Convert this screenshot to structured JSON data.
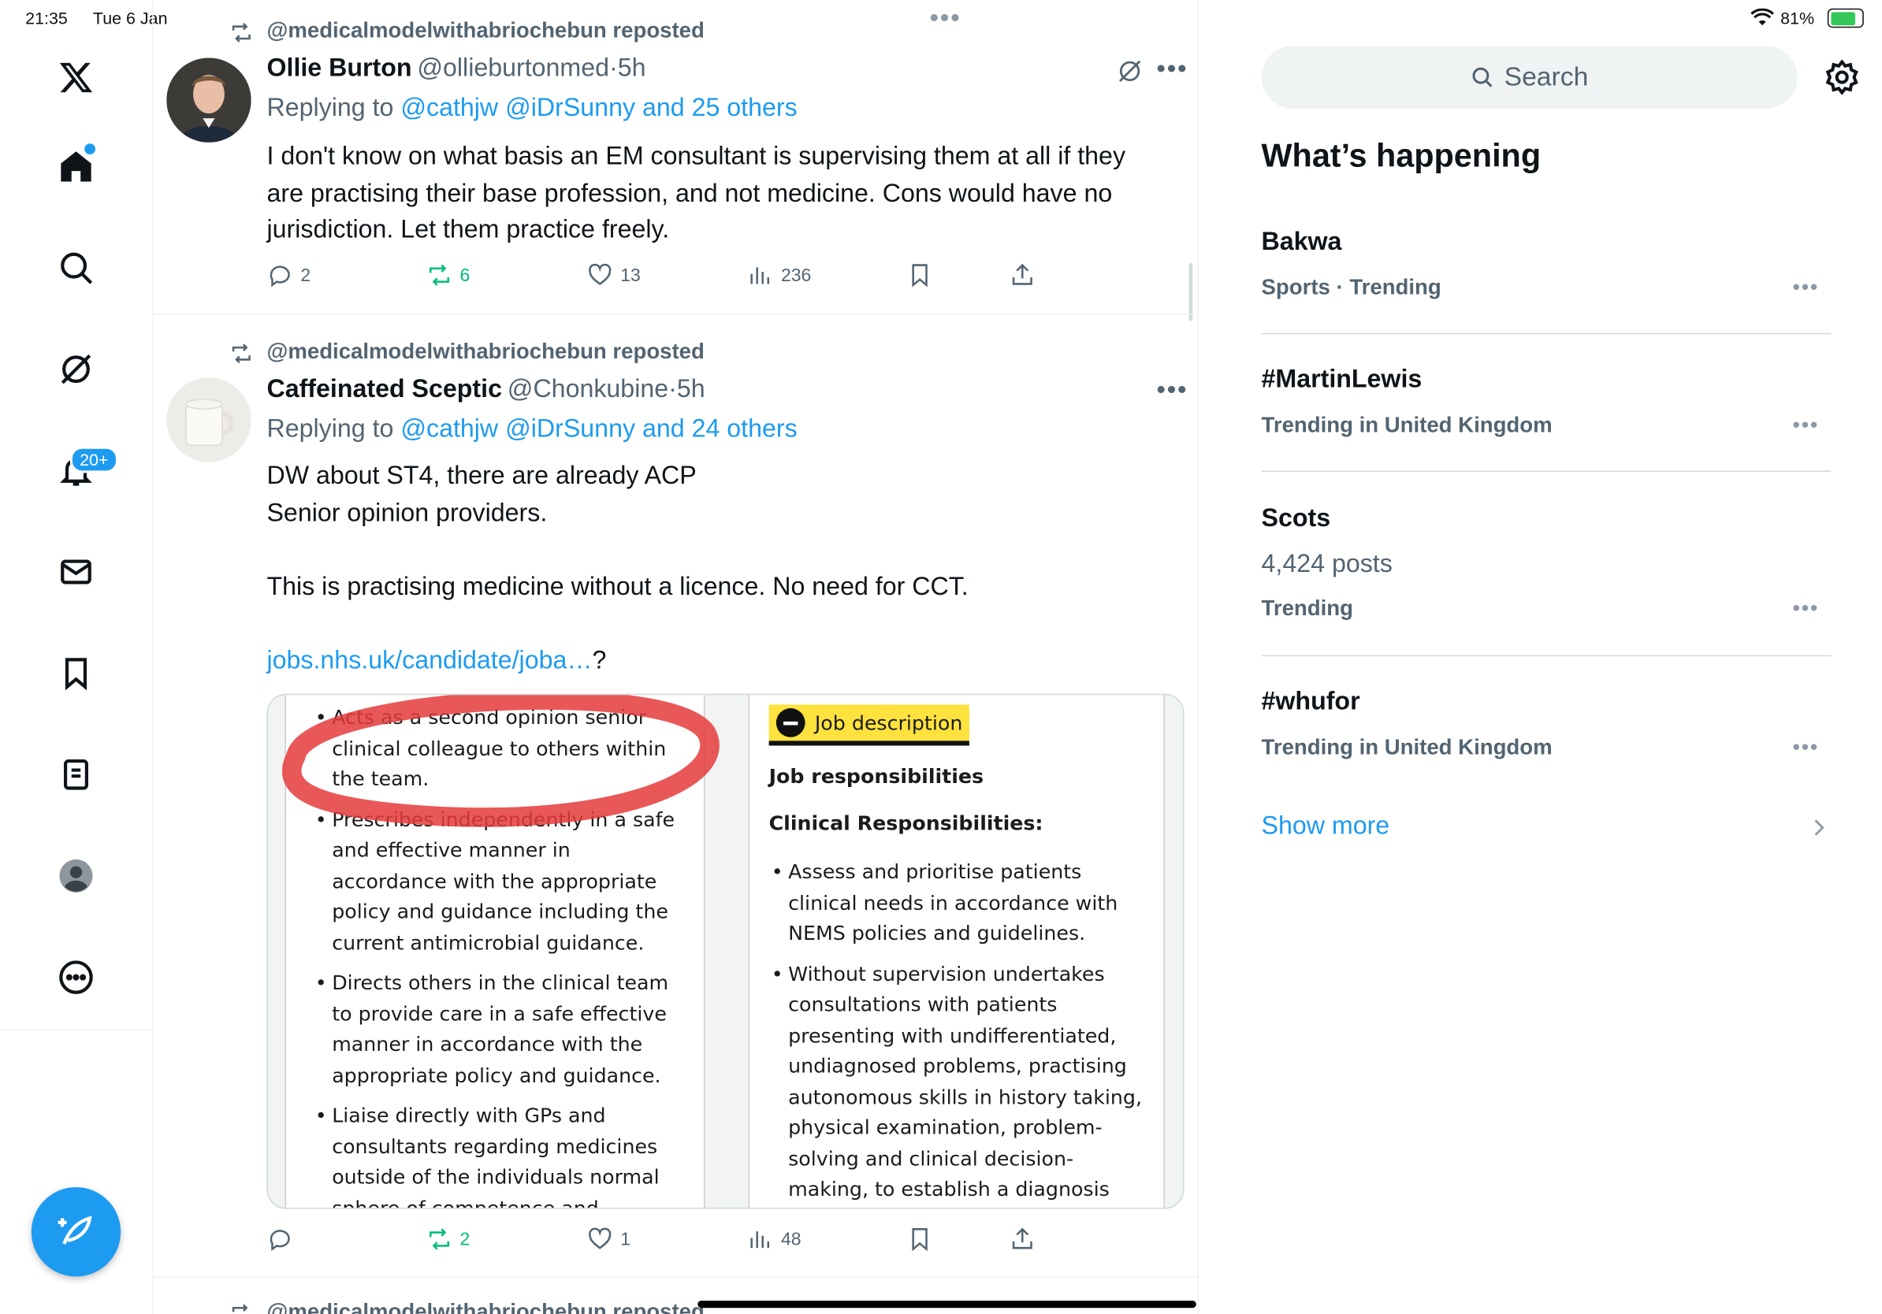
{
  "status": {
    "time": "21:35",
    "date": "Tue 6 Jan",
    "battery": "81%"
  },
  "nav": {
    "notifications_badge": "20+",
    "items": [
      "x-logo",
      "home",
      "search",
      "grok",
      "notifications",
      "messages",
      "bookmarks",
      "lists",
      "profile",
      "more"
    ]
  },
  "tweets": [
    {
      "repost_label": "@medicalmodelwithabriochebun reposted",
      "name": "Ollie Burton",
      "handle": "@ollieburtonmed",
      "sep": "·",
      "time": "5h",
      "replying_prefix": "Replying to ",
      "replying_to": "@cathjw @iDrSunny and 25 others",
      "body_lines": [
        "I don't know on what basis an EM consultant is supervising them at all if they",
        "are practising their base profession, and not medicine. Cons would have no",
        "jurisdiction. Let them practice freely."
      ],
      "replies": "2",
      "reposts": "6",
      "likes": "13",
      "views": "236"
    },
    {
      "repost_label": "@medicalmodelwithabriochebun reposted",
      "name": "Caffeinated Sceptic",
      "handle": "@Chonkubine",
      "sep": "·",
      "time": "5h",
      "replying_prefix": "Replying to ",
      "replying_to": "@cathjw @iDrSunny and 24 others",
      "body_lines": [
        "DW about ST4, there are already ACP",
        "Senior opinion providers.",
        "",
        "This is practising medicine without a licence. No need for CCT.",
        ""
      ],
      "link_text": "jobs.nhs.uk/candidate/joba…",
      "link_suffix": "?",
      "replies": "",
      "reposts": "2",
      "likes": "1",
      "views": "48",
      "media": {
        "left_bullets": [
          "Acts as a second opinion senior clinical colleague to others within the team.",
          "Prescribes independently in a safe and effective manner in accordance with the appropriate policy and guidance including the current antimicrobial guidance.",
          "Directs others in the clinical team to provide care in a safe effective manner in accordance with the appropriate policy and guidance.",
          "Liaise directly with GPs and consultants regarding medicines outside of the individuals normal sphere of competence and"
        ],
        "right_tag": "Job description",
        "right_h1": "Job responsibilities",
        "right_h2": "Clinical Responsibilities:",
        "right_bullets": [
          "Assess and prioritise patients clinical needs in accordance with NEMS policies and guidelines.",
          "Without supervision undertakes consultations with patients presenting with undifferentiated, undiagnosed problems, practising autonomous skills in history taking, physical examination, problem-solving and clinical decision-making, to establish a diagnosis and"
        ]
      }
    },
    {
      "repost_label": "@medicalmodelwithabriochebun reposted"
    }
  ],
  "sidebar": {
    "search_placeholder": "Search",
    "heading": "What’s happening",
    "trends": [
      {
        "title": "Bakwa",
        "meta": "Sports · Trending",
        "count": ""
      },
      {
        "title": "#MartinLewis",
        "meta": "Trending in United Kingdom",
        "count": ""
      },
      {
        "title": "Scots",
        "meta": "Trending",
        "count": "4,424 posts"
      },
      {
        "title": "#whufor",
        "meta": "Trending in United Kingdom",
        "count": ""
      }
    ],
    "show_more": "Show more"
  },
  "colors": {
    "accent": "#1d9bf0",
    "repost_green": "#00ba7c",
    "muted": "#536471"
  }
}
